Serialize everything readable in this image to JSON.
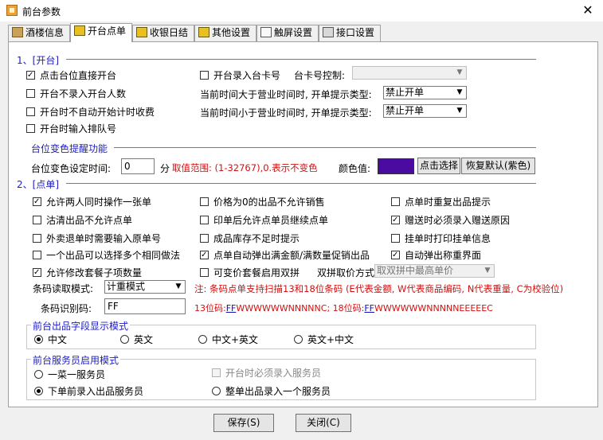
{
  "window": {
    "title": "前台参数",
    "close_glyph": "✕"
  },
  "tabs": [
    {
      "label": "酒楼信息",
      "icon": "restaurant-icon"
    },
    {
      "label": "开台点单",
      "icon": "cube-icon"
    },
    {
      "label": "收银日结",
      "icon": "cube-icon"
    },
    {
      "label": "其他设置",
      "icon": "cube-icon"
    },
    {
      "label": "触屏设置",
      "icon": "touchscreen-icon"
    },
    {
      "label": "接口设置",
      "icon": "interface-icon"
    }
  ],
  "section1": {
    "title": "1、[开台]",
    "cb_click_table": "点击台位直接开台",
    "cb_no_guests": "开台不录入开台人数",
    "cb_no_timing": "开台时不自动开始计时收费",
    "cb_queue_no": "开台时输入排队号",
    "cb_card_no": "开台录入台卡号",
    "card_ctrl_label": "台卡号控制:",
    "card_ctrl_value": "",
    "after_hours_label": "当前时间大于营业时间时, 开单提示类型:",
    "after_hours_value": "禁止开单",
    "before_hours_label": "当前时间小于营业时间时, 开单提示类型:",
    "before_hours_value": "禁止开单",
    "color_group_title": "台位变色提醒功能",
    "color_time_label": "台位变色设定时间:",
    "color_time_value": "0",
    "color_unit": "分",
    "color_range_note": "取值范围: (1-32767),0.表示不变色",
    "color_value_label": "颜色值:",
    "color_swatch": "#4b0aa0",
    "btn_pick": "点击选择",
    "btn_reset": "恢复默认(紫色)"
  },
  "section2": {
    "title": "2、[点单]",
    "col1": [
      {
        "label": "允许两人同时操作一张单",
        "checked": true
      },
      {
        "label": "沽清出品不允许点单",
        "checked": false
      },
      {
        "label": "外卖退单时需要输入原单号",
        "checked": false
      },
      {
        "label": "一个出品可以选择多个相同做法",
        "checked": false
      },
      {
        "label": "允许修改套餐子项数量",
        "checked": true
      }
    ],
    "col2": [
      {
        "label": "价格为0的出品不允许销售",
        "checked": false
      },
      {
        "label": "印单后允许点单员继续点单",
        "checked": false
      },
      {
        "label": "成品库存不足时提示",
        "checked": false
      },
      {
        "label": "点单自动弹出满金额/满数量促销出品",
        "checked": true
      },
      {
        "label": "可变价套餐启用双拼",
        "checked": false
      }
    ],
    "col3": [
      {
        "label": "点单时重复出品提示",
        "checked": false
      },
      {
        "label": "赠送时必须录入赠送原因",
        "checked": true
      },
      {
        "label": "挂单时打印挂单信息",
        "checked": false
      },
      {
        "label": "自动弹出称重界面",
        "checked": true
      }
    ],
    "dual_price_label": "双拼取价方式:",
    "dual_price_value": "取双拼中最高单价",
    "barcode_mode_label": "条码读取模式:",
    "barcode_mode_value": "计重模式",
    "barcode_note": "注: 条码点单支持扫描13和18位条码 (E代表金额, W代表商品编码, N代表重量, C为校验位)",
    "barcode_id_label": "条码识别码:",
    "barcode_id_value": "FF",
    "code13_label": "13位码:",
    "code13_prefix": "FF",
    "code13_rest": "WWWWWWNNNNNC",
    "code18_label": "; 18位码:",
    "code18_prefix": "FF",
    "code18_rest": "WWWWWWNNNNNEEEEEC"
  },
  "display_mode": {
    "title": "前台出品字段显示模式",
    "options": [
      {
        "label": "中文",
        "checked": true
      },
      {
        "label": "英文",
        "checked": false
      },
      {
        "label": "中文+英文",
        "checked": false
      },
      {
        "label": "英文+中文",
        "checked": false
      }
    ]
  },
  "waiter_mode": {
    "title": "前台服务员启用模式",
    "opt_one_dish": "一菜一服务员",
    "opt_before_order": "下单前录入出品服务员",
    "opt_whole_order": "整单出品录入一个服务员",
    "cb_must_waiter": "开台时必须录入服务员",
    "checked_option": "opt_before_order"
  },
  "footer": {
    "save": "保存(S)",
    "close": "关闭(C)"
  }
}
